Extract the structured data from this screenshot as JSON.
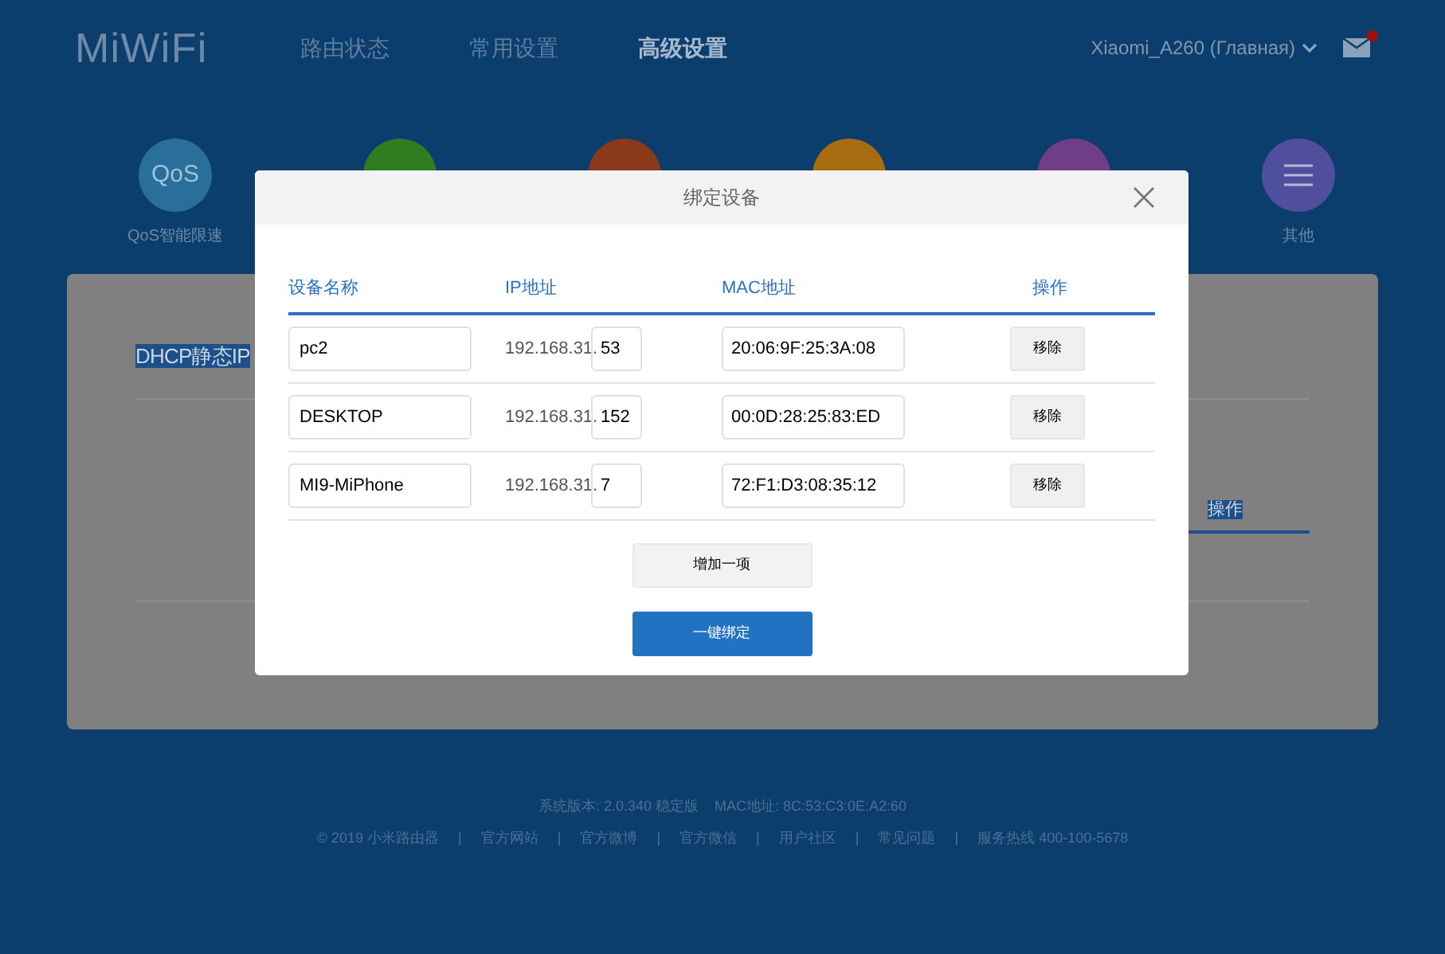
{
  "header": {
    "logo": "MiWiFi",
    "nav": [
      {
        "label": "路由状态",
        "selected": false
      },
      {
        "label": "常用设置",
        "selected": false
      },
      {
        "label": "高级设置",
        "selected": true
      }
    ],
    "router_name": "Xiaomi_A260 (Главная)",
    "mail_unread": true
  },
  "apps": [
    {
      "kind": "text",
      "icon_text": "QoS",
      "label": "QoS智能限速",
      "color": "#2a6f9a"
    },
    {
      "kind": "blank",
      "color": "#2e7d1f"
    },
    {
      "kind": "blank",
      "color": "#8a3a1a"
    },
    {
      "kind": "blank",
      "color": "#a86d10"
    },
    {
      "kind": "blank",
      "color": "#6f3e87"
    },
    {
      "kind": "menu",
      "label": "其他",
      "color": "#4f4f9e"
    }
  ],
  "background_card": {
    "title": "DHCP静态IP",
    "column_header": "操作"
  },
  "dialog": {
    "title": "绑定设备",
    "columns": [
      "设备名称",
      "IP地址",
      "MAC地址",
      "操作"
    ],
    "rows": [
      {
        "name": "pc2",
        "ip_prefix": "192.168.31.",
        "ip_suffix": "53",
        "mac": "20:06:9F:25:3A:08",
        "action": "移除"
      },
      {
        "name": "DESKTOP",
        "ip_prefix": "192.168.31.",
        "ip_suffix": "152",
        "mac": "00:0D:28:25:83:ED",
        "action": "移除"
      },
      {
        "name": "MI9-MiPhone",
        "ip_prefix": "192.168.31.",
        "ip_suffix": "7",
        "mac": "72:F1:D3:08:35:12",
        "action": "移除"
      }
    ],
    "add_button": "增加一项",
    "bind_button": "一键绑定"
  },
  "footer": {
    "version": "系统版本: 2.0.340 稳定版",
    "mac": "MAC地址: 8C:53:C3:0E:A2:60",
    "separator": "|",
    "links": [
      "© 2019 小米路由器",
      "官方网站",
      "官方微博",
      "官方微信",
      "用户社区",
      "常见问题",
      "服务热线 400-100-5678"
    ]
  }
}
